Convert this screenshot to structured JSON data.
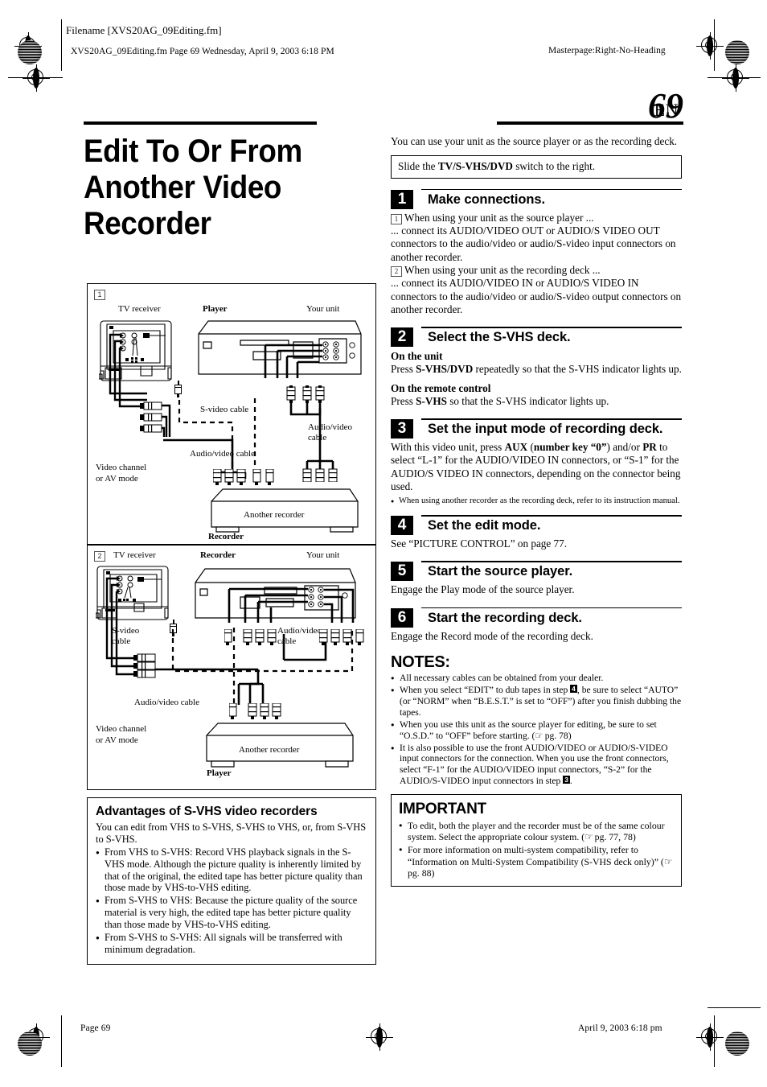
{
  "page": {
    "header_filename_label": "Filename [XVS20AG_09Editing.fm]",
    "header_slug": "XVS20AG_09Editing.fm  Page 69  Wednesday, April 9, 2003  6:18 PM",
    "header_masterpage": "Masterpage:Right-No-Heading",
    "footer_page": "Page 69",
    "footer_date": "April 9, 2003 6:18 pm",
    "lang_code": "EN",
    "page_number": "69",
    "title": "Edit To Or From Another Video Recorder"
  },
  "right_column": {
    "intro": "You can use your unit as the source player or as the recording deck.",
    "slide_box": {
      "prefix": "Slide the ",
      "bold": "TV/S-VHS/DVD",
      "suffix": " switch to the right."
    },
    "steps": [
      {
        "num": "1",
        "title": "Make connections.",
        "lines": [
          "1  When using your unit as the source player ...",
          "... connect its AUDIO/VIDEO OUT or AUDIO/S VIDEO OUT connectors to the audio/video or audio/S-video input connectors on another recorder.",
          "2  When using your unit as the recording deck ...",
          "... connect its AUDIO/VIDEO IN or AUDIO/S VIDEO IN connectors to the audio/video or audio/S-video output connectors on another recorder."
        ]
      },
      {
        "num": "2",
        "title": "Select the S-VHS deck.",
        "sub1_head": "On the unit",
        "sub1_body": "Press S-VHS/DVD repeatedly so that the S-VHS indicator lights up.",
        "sub2_head": "On the remote control",
        "sub2_body": "Press S-VHS so that the S-VHS indicator lights up."
      },
      {
        "num": "3",
        "title": "Set the input mode of recording deck.",
        "body": "With this video unit, press AUX (number key “0”) and/or PR to select “L-1” for the AUDIO/VIDEO IN connectors, or “S-1” for the AUDIO/S VIDEO IN connectors, depending on the connector being used.",
        "note": "When using another recorder as the recording deck, refer to its instruction manual."
      },
      {
        "num": "4",
        "title": "Set the edit mode.",
        "body": "See “PICTURE CONTROL” on page 77."
      },
      {
        "num": "5",
        "title": "Start the source player.",
        "body": "Engage the Play mode of the source player."
      },
      {
        "num": "6",
        "title": "Start the recording deck.",
        "body": "Engage the Record mode of the recording deck."
      }
    ],
    "notes": {
      "heading": "NOTES:",
      "items": [
        "All necessary cables can be obtained from your dealer.",
        "When you select “EDIT” to dub tapes in step 4, be sure to select “AUTO” (or “NORM” when “B.E.S.T.” is set to “OFF”) after you finish dubbing the tapes.",
        "When you use this unit as the source player for editing, be sure to set “O.S.D.” to “OFF” before starting. (☞ pg. 78)",
        "It is also possible to use the front AUDIO/VIDEO or AUDIO/S-VIDEO input connectors for the connection. When you use the front connectors, select “F-1” for the AUDIO/VIDEO input connectors, “S-2” for the AUDIO/S-VIDEO input connectors in step 3."
      ]
    },
    "important": {
      "heading": "IMPORTANT",
      "items": [
        "To edit, both the player and the recorder must be of the same colour system. Select the appropriate colour system. (☞ pg. 77, 78)",
        "For more information on multi-system compatibility, refer to “Information on Multi-System Compatibility (S-VHS deck only)” (☞ pg. 88)"
      ]
    }
  },
  "figures": [
    {
      "num": "1",
      "labels": {
        "tv": "TV receiver",
        "center_device": "Player",
        "right_device": "Your unit",
        "svideo_cable": "S-video cable",
        "av_cable_right": "Audio/video cable",
        "av_cable_left": "Audio/video cable",
        "video_channel": "Video channel or AV mode",
        "bottom_device": "Another recorder",
        "bottom_role": "Recorder"
      }
    },
    {
      "num": "2",
      "labels": {
        "tv": "TV receiver",
        "center_device": "Recorder",
        "right_device": "Your unit",
        "svideo_cable": "S-video cable",
        "av_cable_right": "Audio/video cable",
        "av_cable_left": "Audio/video cable",
        "video_channel": "Video channel or AV mode",
        "bottom_device": "Another recorder",
        "bottom_role": "Player"
      }
    }
  ],
  "advantages": {
    "heading": "Advantages of S-VHS video recorders",
    "intro": "You can edit from VHS to S-VHS, S-VHS to VHS, or, from S-VHS to S-VHS.",
    "items": [
      "From VHS to S-VHS: Record VHS playback signals in the S-VHS mode. Although the picture quality is inherently limited by that of the original, the edited tape has better picture quality than those made by VHS-to-VHS editing.",
      "From S-VHS to VHS: Because the picture quality of the source material is very high, the edited tape has better picture quality than those made by VHS-to-VHS editing.",
      "From S-VHS to S-VHS: All signals will be transferred with minimum degradation."
    ]
  }
}
